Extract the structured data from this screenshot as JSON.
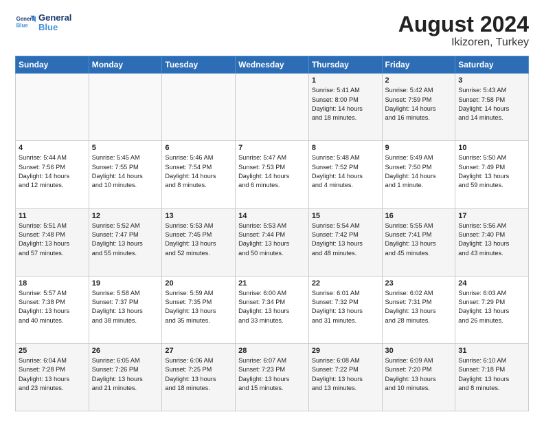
{
  "header": {
    "logo_line1": "General",
    "logo_line2": "Blue",
    "title": "August 2024",
    "subtitle": "Ikizoren, Turkey"
  },
  "calendar": {
    "weekdays": [
      "Sunday",
      "Monday",
      "Tuesday",
      "Wednesday",
      "Thursday",
      "Friday",
      "Saturday"
    ],
    "weeks": [
      [
        {
          "day": "",
          "info": ""
        },
        {
          "day": "",
          "info": ""
        },
        {
          "day": "",
          "info": ""
        },
        {
          "day": "",
          "info": ""
        },
        {
          "day": "1",
          "info": "Sunrise: 5:41 AM\nSunset: 8:00 PM\nDaylight: 14 hours\nand 18 minutes."
        },
        {
          "day": "2",
          "info": "Sunrise: 5:42 AM\nSunset: 7:59 PM\nDaylight: 14 hours\nand 16 minutes."
        },
        {
          "day": "3",
          "info": "Sunrise: 5:43 AM\nSunset: 7:58 PM\nDaylight: 14 hours\nand 14 minutes."
        }
      ],
      [
        {
          "day": "4",
          "info": "Sunrise: 5:44 AM\nSunset: 7:56 PM\nDaylight: 14 hours\nand 12 minutes."
        },
        {
          "day": "5",
          "info": "Sunrise: 5:45 AM\nSunset: 7:55 PM\nDaylight: 14 hours\nand 10 minutes."
        },
        {
          "day": "6",
          "info": "Sunrise: 5:46 AM\nSunset: 7:54 PM\nDaylight: 14 hours\nand 8 minutes."
        },
        {
          "day": "7",
          "info": "Sunrise: 5:47 AM\nSunset: 7:53 PM\nDaylight: 14 hours\nand 6 minutes."
        },
        {
          "day": "8",
          "info": "Sunrise: 5:48 AM\nSunset: 7:52 PM\nDaylight: 14 hours\nand 4 minutes."
        },
        {
          "day": "9",
          "info": "Sunrise: 5:49 AM\nSunset: 7:50 PM\nDaylight: 14 hours\nand 1 minute."
        },
        {
          "day": "10",
          "info": "Sunrise: 5:50 AM\nSunset: 7:49 PM\nDaylight: 13 hours\nand 59 minutes."
        }
      ],
      [
        {
          "day": "11",
          "info": "Sunrise: 5:51 AM\nSunset: 7:48 PM\nDaylight: 13 hours\nand 57 minutes."
        },
        {
          "day": "12",
          "info": "Sunrise: 5:52 AM\nSunset: 7:47 PM\nDaylight: 13 hours\nand 55 minutes."
        },
        {
          "day": "13",
          "info": "Sunrise: 5:53 AM\nSunset: 7:45 PM\nDaylight: 13 hours\nand 52 minutes."
        },
        {
          "day": "14",
          "info": "Sunrise: 5:53 AM\nSunset: 7:44 PM\nDaylight: 13 hours\nand 50 minutes."
        },
        {
          "day": "15",
          "info": "Sunrise: 5:54 AM\nSunset: 7:42 PM\nDaylight: 13 hours\nand 48 minutes."
        },
        {
          "day": "16",
          "info": "Sunrise: 5:55 AM\nSunset: 7:41 PM\nDaylight: 13 hours\nand 45 minutes."
        },
        {
          "day": "17",
          "info": "Sunrise: 5:56 AM\nSunset: 7:40 PM\nDaylight: 13 hours\nand 43 minutes."
        }
      ],
      [
        {
          "day": "18",
          "info": "Sunrise: 5:57 AM\nSunset: 7:38 PM\nDaylight: 13 hours\nand 40 minutes."
        },
        {
          "day": "19",
          "info": "Sunrise: 5:58 AM\nSunset: 7:37 PM\nDaylight: 13 hours\nand 38 minutes."
        },
        {
          "day": "20",
          "info": "Sunrise: 5:59 AM\nSunset: 7:35 PM\nDaylight: 13 hours\nand 35 minutes."
        },
        {
          "day": "21",
          "info": "Sunrise: 6:00 AM\nSunset: 7:34 PM\nDaylight: 13 hours\nand 33 minutes."
        },
        {
          "day": "22",
          "info": "Sunrise: 6:01 AM\nSunset: 7:32 PM\nDaylight: 13 hours\nand 31 minutes."
        },
        {
          "day": "23",
          "info": "Sunrise: 6:02 AM\nSunset: 7:31 PM\nDaylight: 13 hours\nand 28 minutes."
        },
        {
          "day": "24",
          "info": "Sunrise: 6:03 AM\nSunset: 7:29 PM\nDaylight: 13 hours\nand 26 minutes."
        }
      ],
      [
        {
          "day": "25",
          "info": "Sunrise: 6:04 AM\nSunset: 7:28 PM\nDaylight: 13 hours\nand 23 minutes."
        },
        {
          "day": "26",
          "info": "Sunrise: 6:05 AM\nSunset: 7:26 PM\nDaylight: 13 hours\nand 21 minutes."
        },
        {
          "day": "27",
          "info": "Sunrise: 6:06 AM\nSunset: 7:25 PM\nDaylight: 13 hours\nand 18 minutes."
        },
        {
          "day": "28",
          "info": "Sunrise: 6:07 AM\nSunset: 7:23 PM\nDaylight: 13 hours\nand 15 minutes."
        },
        {
          "day": "29",
          "info": "Sunrise: 6:08 AM\nSunset: 7:22 PM\nDaylight: 13 hours\nand 13 minutes."
        },
        {
          "day": "30",
          "info": "Sunrise: 6:09 AM\nSunset: 7:20 PM\nDaylight: 13 hours\nand 10 minutes."
        },
        {
          "day": "31",
          "info": "Sunrise: 6:10 AM\nSunset: 7:18 PM\nDaylight: 13 hours\nand 8 minutes."
        }
      ]
    ]
  }
}
